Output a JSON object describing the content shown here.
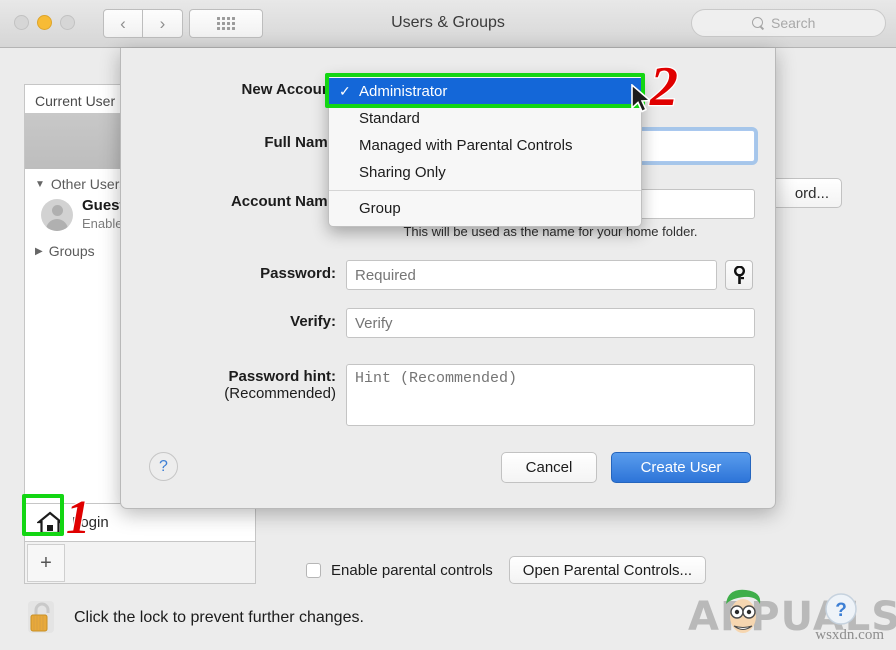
{
  "window": {
    "title": "Users & Groups",
    "traffic_lights": [
      "close",
      "minimize",
      "zoom"
    ],
    "nav": {
      "back": "‹",
      "forward": "›"
    },
    "show_all_icon": "grid-icon",
    "search": {
      "placeholder": "Search",
      "value": "",
      "icon": "search-icon"
    }
  },
  "sidebar": {
    "current_user_header": "Current User",
    "other_users_header": "Other Users",
    "guest": {
      "name": "Guest",
      "status": "Enabled"
    },
    "groups_header": "Groups",
    "login_label": "Login",
    "add_button": "+",
    "disclosure_open": "▼",
    "disclosure_closed": "▶"
  },
  "right_pane": {
    "change_password_button": "ord...",
    "parental": {
      "checkbox_label": "Enable parental controls",
      "checked": false,
      "open_button": "Open Parental Controls..."
    }
  },
  "lock": {
    "icon": "unlocked-padlock-icon",
    "text": "Click the lock to prevent further changes."
  },
  "sheet": {
    "fields": {
      "new_account_label": "New Account",
      "full_name_label": "Full Name",
      "full_name_value": "",
      "account_name_label": "Account Name",
      "account_name_value": "",
      "home_folder_note": "This will be used as the name for your home folder.",
      "password_label": "Password:",
      "password_placeholder": "Required",
      "verify_label": "Verify:",
      "verify_placeholder": "Verify",
      "hint_label": "Password hint:",
      "hint_sublabel": "(Recommended)",
      "hint_placeholder": "Hint (Recommended)",
      "key_button_icon": "key-icon"
    },
    "help_button": "?",
    "cancel_button": "Cancel",
    "create_button": "Create User"
  },
  "popup_menu": {
    "selected": "Administrator",
    "check_glyph": "✓",
    "items": [
      {
        "label": "Administrator",
        "selected": true
      },
      {
        "label": "Standard",
        "selected": false
      },
      {
        "label": "Managed with Parental Controls",
        "selected": false
      },
      {
        "label": "Sharing Only",
        "selected": false
      }
    ],
    "group_item": {
      "label": "Group",
      "selected": false
    }
  },
  "annotations": {
    "step_one": "1",
    "step_two": "2",
    "highlight_color": "#13d613",
    "marker_color": "#e00000"
  },
  "watermark": {
    "brand": "APPUALS",
    "url": "wsxdn.com"
  }
}
